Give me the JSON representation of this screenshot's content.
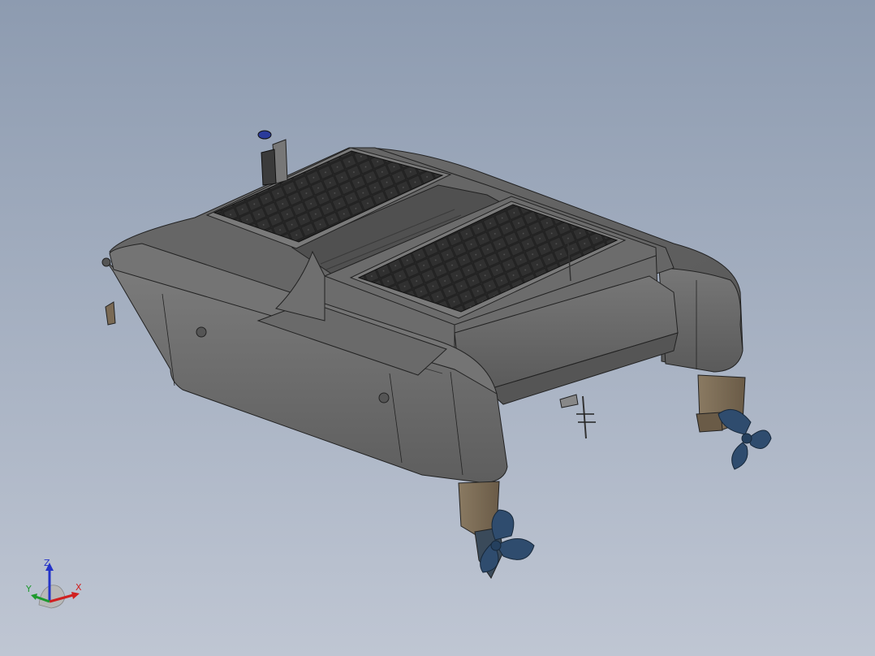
{
  "viewport": {
    "background_top": "#8d9bb0",
    "background_bottom": "#bfc6d3"
  },
  "model": {
    "hull_color": "#6e6e6e",
    "panel_color": "#2b2b2b",
    "propeller_color": "#2f4c6e",
    "strut_color": "#7a6a55"
  },
  "triad": {
    "z_label": "Z",
    "y_label": "Y",
    "x_label": "X",
    "z_color": "#2433c8",
    "y_color": "#1e9a2e",
    "x_color": "#d02020"
  }
}
